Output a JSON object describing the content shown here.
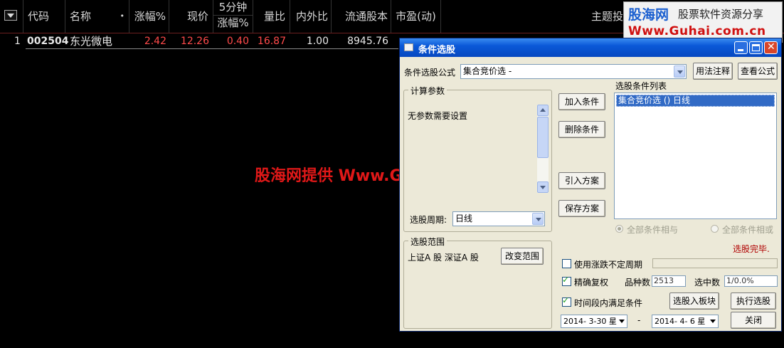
{
  "grid": {
    "menu_icon": "dropdown-arrow-icon",
    "headers": {
      "code": "代码",
      "name": "名称",
      "dot": "•",
      "change_pct": "涨幅%",
      "price": "现价",
      "five_min_top": "5分钟",
      "five_min_bottom": "涨幅%",
      "volume_ratio": "量比",
      "in_out_ratio": "内外比",
      "float_shares": "流通股本",
      "pe_dynamic": "市盈(动)",
      "theme": "主题投"
    },
    "rows": [
      {
        "index": "1",
        "code": "002504",
        "name": "东光微电",
        "change_pct": "2.42",
        "price": "12.26",
        "five_min_change": "0.40",
        "volume_ratio": "16.87",
        "in_out_ratio": "1.00",
        "float_shares": "8945.76"
      }
    ]
  },
  "watermark": {
    "logo_text": "股海网",
    "slogan": "股票软件资源分享",
    "url": "Www.Guhai.com.cn",
    "center_text": "股海网提供 Www.Guhai.Com.CN"
  },
  "dialog": {
    "title": "条件选股",
    "formula_label": "条件选股公式",
    "formula_value": "集合竞价选 -",
    "usage_button": "用法注释",
    "view_formula_button": "查看公式",
    "params_group": "计算参数",
    "params_text": "无参数需要设置",
    "add_condition": "加入条件",
    "delete_condition": "删除条件",
    "import_plan": "引入方案",
    "save_plan": "保存方案",
    "condition_list_label": "选股条件列表",
    "conditions": [
      "集合竞价选  () 日线"
    ],
    "period_label": "选股周期:",
    "period_value": "日线",
    "range_group": "选股范围",
    "range_text": "上证A 股  深证A 股",
    "change_range": "改变范围",
    "radio_and": "全部条件相与",
    "radio_or": "全部条件相或",
    "status": "选股完毕.",
    "use_undetermined_period": "使用涨跌不定周期",
    "precise_adjust": "精确复权",
    "stock_count_label": "品种数",
    "stock_count": "2513",
    "selected_label": "选中数",
    "selected_value": "1/0.0%",
    "time_range_label": "时间段内满足条件",
    "to_block": "选股入板块",
    "execute": "执行选股",
    "close": "关闭",
    "date_from": "2014- 3-30 星",
    "date_sep": "-",
    "date_to": "2014- 4- 6 星",
    "colors": {
      "status": "#b00000",
      "selection": "#316ac5",
      "title_bar": "#0a58d8"
    }
  }
}
